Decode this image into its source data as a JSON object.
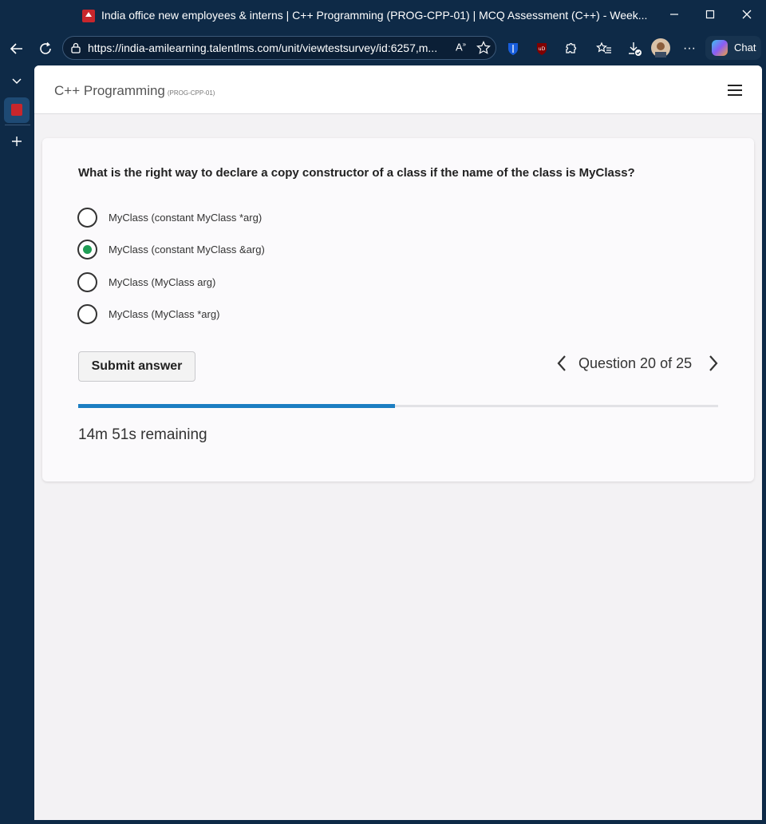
{
  "window": {
    "title": "India office new employees & interns | C++ Programming (PROG-CPP-01) | MCQ Assessment (C++) - Week...",
    "controls": [
      "minimize-icon",
      "maximize-icon",
      "close-icon"
    ]
  },
  "browser": {
    "url": "https://india-amilearning.talentlms.com/unit/viewtestsurvey/id:6257,m...",
    "chat_label": "Chat",
    "toolbar_icons": [
      "back-arrow-icon",
      "refresh-icon",
      "lock-icon",
      "read-aloud-icon",
      "favorite-star-icon",
      "bitwarden-icon",
      "ublock-icon",
      "extensions-icon",
      "favorites-icon",
      "downloads-icon",
      "profile-avatar",
      "more-icon"
    ]
  },
  "header": {
    "course_title": "C++ Programming",
    "course_code": "(PROG-CPP-01)"
  },
  "quiz": {
    "question": "What is the right way to declare a copy constructor of a class if the name of the class is MyClass?",
    "options": [
      {
        "label": "MyClass (constant MyClass *arg)",
        "selected": false
      },
      {
        "label": "MyClass (constant MyClass &arg)",
        "selected": true
      },
      {
        "label": "MyClass (MyClass arg)",
        "selected": false
      },
      {
        "label": "MyClass (MyClass *arg)",
        "selected": false
      }
    ],
    "submit_label": "Submit answer",
    "question_counter": "Question 20 of 25",
    "progress_fraction": 0.495,
    "time_remaining": "14m 51s remaining"
  },
  "colors": {
    "window_bg": "#0e2a47",
    "selected_radio": "#1f9d55",
    "progress": "#1c7ec2"
  }
}
